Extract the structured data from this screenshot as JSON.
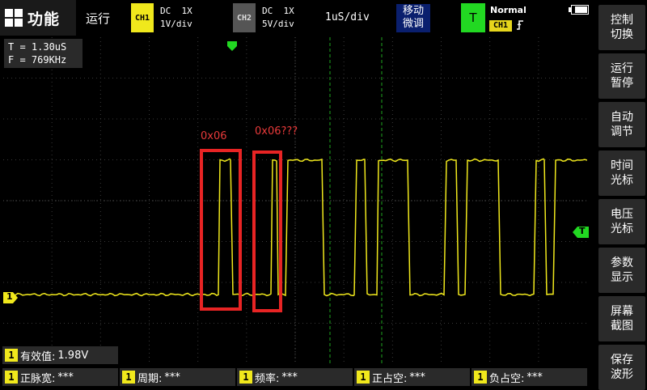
{
  "topbar": {
    "menu_label": "功能",
    "run_state": "运行",
    "ch1": {
      "tag": "CH1",
      "coupling": "DC  1X",
      "scale": "1V/div",
      "color": "#f0e81c"
    },
    "ch2": {
      "tag": "CH2",
      "coupling": "DC  1X",
      "scale": "5V/div",
      "color": "#555555"
    },
    "timebase": "1uS/div",
    "mode_line1": "移动",
    "mode_line2": "微调",
    "trigger": {
      "label": "T",
      "mode": "Normal",
      "source": "CH1",
      "edge_icon": "rising-edge-icon"
    },
    "battery_icon": "battery-icon"
  },
  "sidebar": {
    "items": [
      {
        "line1": "控制",
        "line2": "切换"
      },
      {
        "line1": "运行",
        "line2": "暂停"
      },
      {
        "line1": "自动",
        "line2": "调节"
      },
      {
        "line1": "时间",
        "line2": "光标"
      },
      {
        "line1": "电压",
        "line2": "光标"
      },
      {
        "line1": "参数",
        "line2": "显示"
      },
      {
        "line1": "屏幕",
        "line2": "截图"
      },
      {
        "line1": "保存",
        "line2": "波形"
      }
    ]
  },
  "screen": {
    "cursor_readout": {
      "period": "T = 1.30uS",
      "freq": "F = 769KHz"
    },
    "ch1_marker": "1",
    "trigger_marker": "T",
    "annotations": [
      {
        "label": "0x06"
      },
      {
        "label": "0x06???"
      }
    ],
    "trace_color": "#f0e81c",
    "cursor_color": "#1ea51e"
  },
  "measurements": {
    "rms": {
      "channel": "1",
      "label": "有效值:",
      "value": "1.98V"
    },
    "items": [
      {
        "channel": "1",
        "label": "正脉宽:",
        "value": "***"
      },
      {
        "channel": "1",
        "label": "周期:",
        "value": "***"
      },
      {
        "channel": "1",
        "label": "频率:",
        "value": "***"
      },
      {
        "channel": "1",
        "label": "正占空:",
        "value": "***"
      },
      {
        "channel": "1",
        "label": "负占空:",
        "value": "***"
      }
    ]
  }
}
